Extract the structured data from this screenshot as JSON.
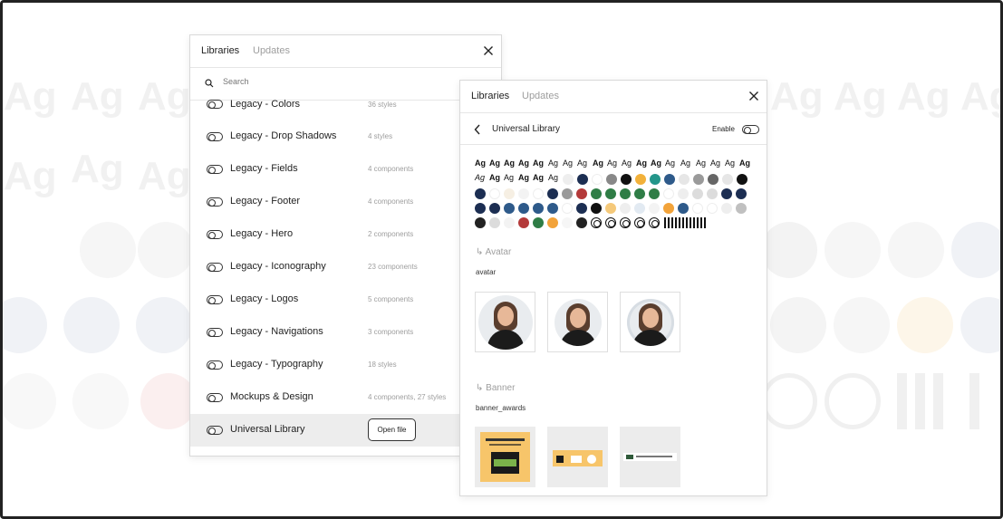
{
  "background": {
    "ag_text": "Ag",
    "colors": {
      "navy": "#f0f2f6",
      "green": "#f0f7f2",
      "yellow": "#fdf6e9",
      "red": "#fbefef",
      "gray": "#f4f4f4"
    }
  },
  "left_panel": {
    "tabs": {
      "libraries": "Libraries",
      "updates": "Updates"
    },
    "search_placeholder": "Search",
    "libraries": [
      {
        "name": "Legacy - Colors",
        "meta": "36 styles"
      },
      {
        "name": "Legacy - Drop Shadows",
        "meta": "4 styles"
      },
      {
        "name": "Legacy - Fields",
        "meta": "4 components"
      },
      {
        "name": "Legacy - Footer",
        "meta": "4 components"
      },
      {
        "name": "Legacy - Hero",
        "meta": "2 components"
      },
      {
        "name": "Legacy - Iconography",
        "meta": "23 components"
      },
      {
        "name": "Legacy - Logos",
        "meta": "5 components"
      },
      {
        "name": "Legacy - Navigations",
        "meta": "3 components"
      },
      {
        "name": "Legacy - Typography",
        "meta": "18 styles"
      },
      {
        "name": "Mockups & Design",
        "meta": "4 components, 27 styles"
      },
      {
        "name": "Universal Library",
        "meta": ""
      }
    ],
    "open_file_label": "Open file"
  },
  "right_panel": {
    "tabs": {
      "libraries": "Libraries",
      "updates": "Updates"
    },
    "library_title": "Universal Library",
    "enable_label": "Enable",
    "type_sample": "Ag",
    "sections": [
      {
        "title": "↳ Avatar",
        "subtitle": "avatar"
      },
      {
        "title": "↳ Banner",
        "subtitle": "banner_awards"
      }
    ],
    "swatch_colors": {
      "navy": "#1c2e52",
      "white": "#ffffff",
      "cream": "#f6efe3",
      "blue": "#2e5a8a",
      "gray": "#9a9a9a",
      "red": "#b43a3a",
      "green": "#2f7d46",
      "yellow": "#f2b13a",
      "teal": "#24968a",
      "black": "#111111",
      "lightgray": "#dcdcdc",
      "darkgray": "#666666",
      "paleblue": "#e2eaf2"
    }
  }
}
